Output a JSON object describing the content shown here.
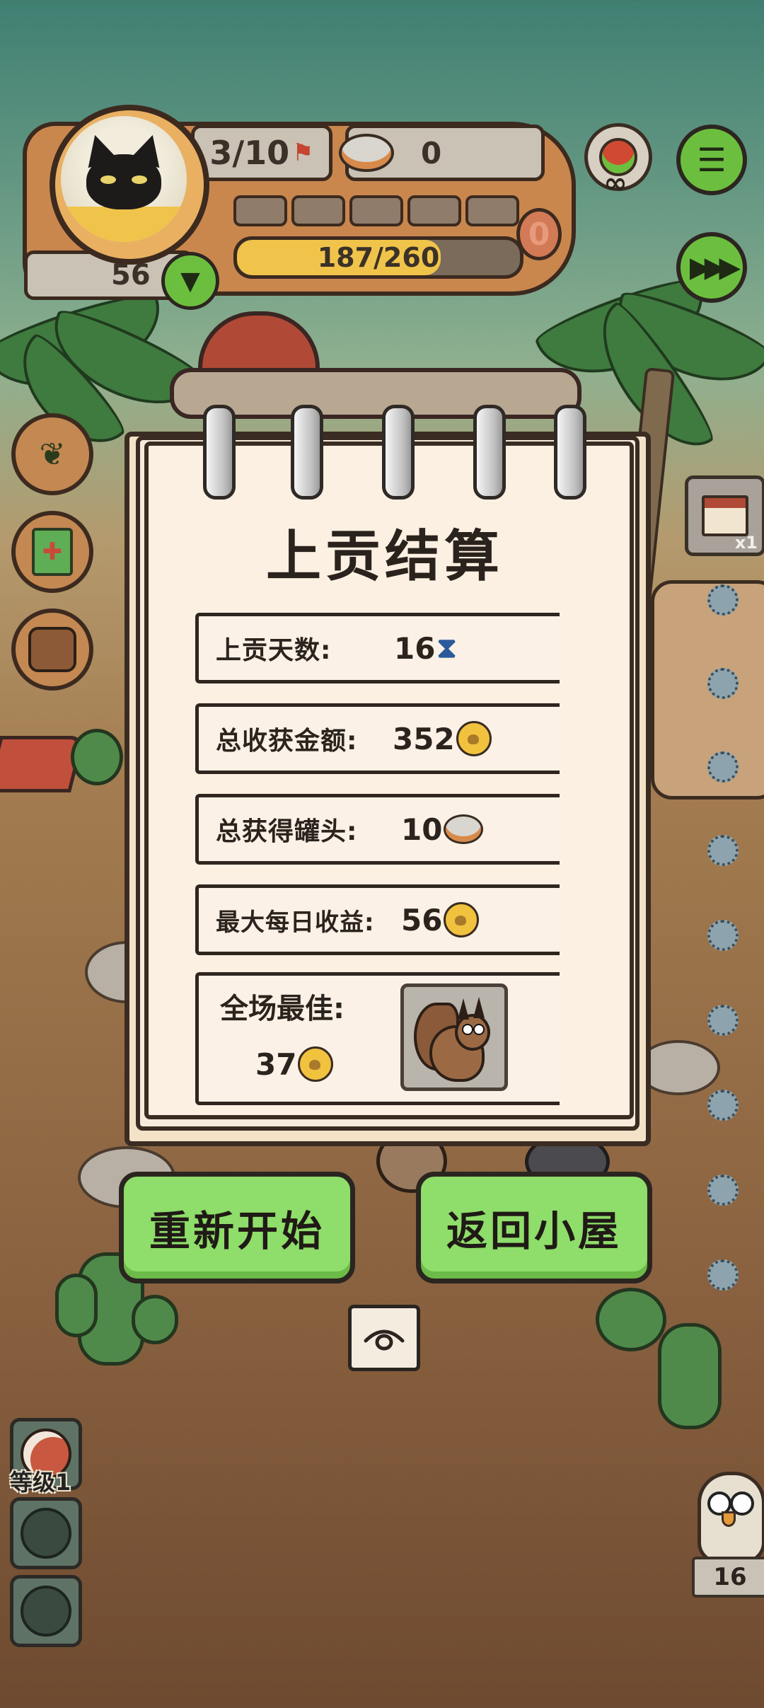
{
  "hud": {
    "population": "3/10",
    "cans": "0",
    "xp_text": "187/260",
    "xp_ratio": 0.72,
    "level_segments_filled": 0,
    "level_segments_total": 5,
    "badge_zero": "0",
    "coins": "56",
    "infinity": "∞"
  },
  "side_right": {
    "house_multiplier": "x1"
  },
  "summary": {
    "title": "上贡结算",
    "rows": [
      {
        "label": "上贡天数:",
        "value": "16",
        "icon": "hourglass-icon"
      },
      {
        "label": "总收获金额:",
        "value": "352",
        "icon": "paw-coin-icon"
      },
      {
        "label": "总获得罐头:",
        "value": "10",
        "icon": "can-icon"
      },
      {
        "label": "最大每日收益:",
        "value": "56",
        "icon": "paw-coin-icon"
      }
    ],
    "best": {
      "label": "全场最佳:",
      "value": "37",
      "icon": "paw-coin-icon",
      "portrait": "squirrel"
    }
  },
  "buttons": {
    "restart": "重新开始",
    "return_home": "返回小屋"
  },
  "bottom_left": {
    "level_label": "等级1"
  },
  "bottom_right": {
    "owl_count": "16"
  },
  "colors": {
    "accent_green": "#8fdd6a",
    "paper": "#fbf0e2",
    "ink": "#2a221c"
  }
}
